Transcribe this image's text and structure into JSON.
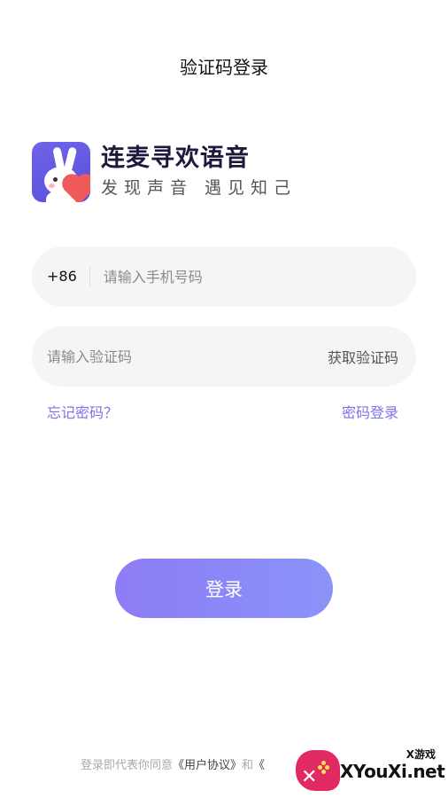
{
  "header": {
    "title": "验证码登录"
  },
  "brand": {
    "name": "连麦寻欢语音",
    "slogan": "发现声音 遇见知己"
  },
  "phone_field": {
    "prefix": "+86",
    "placeholder": "请输入手机号码",
    "value": ""
  },
  "code_field": {
    "placeholder": "请输入验证码",
    "value": "",
    "action_label": "获取验证码"
  },
  "links": {
    "forgot_password": "忘记密码？",
    "password_login": "密码登录"
  },
  "login_button": {
    "label": "登录"
  },
  "agreement": {
    "prefix": "登录即代表你同意",
    "user_agreement": "《用户协议》",
    "conjunction": "和",
    "privacy_prefix": "《"
  },
  "watermark": {
    "top_text": "X游戏",
    "main_text": "XYouXi.net"
  },
  "colors": {
    "accent": "#7b74e6",
    "button_start": "#8d7cf6",
    "button_end": "#8a93f8",
    "field_bg": "#f5f5f5",
    "logo_bg": "#5a4fd9",
    "watermark_red": "#e12a62"
  },
  "icons": {
    "logo": "rabbit-heart-logo-icon",
    "watermark": "gamepad-logo-icon"
  }
}
